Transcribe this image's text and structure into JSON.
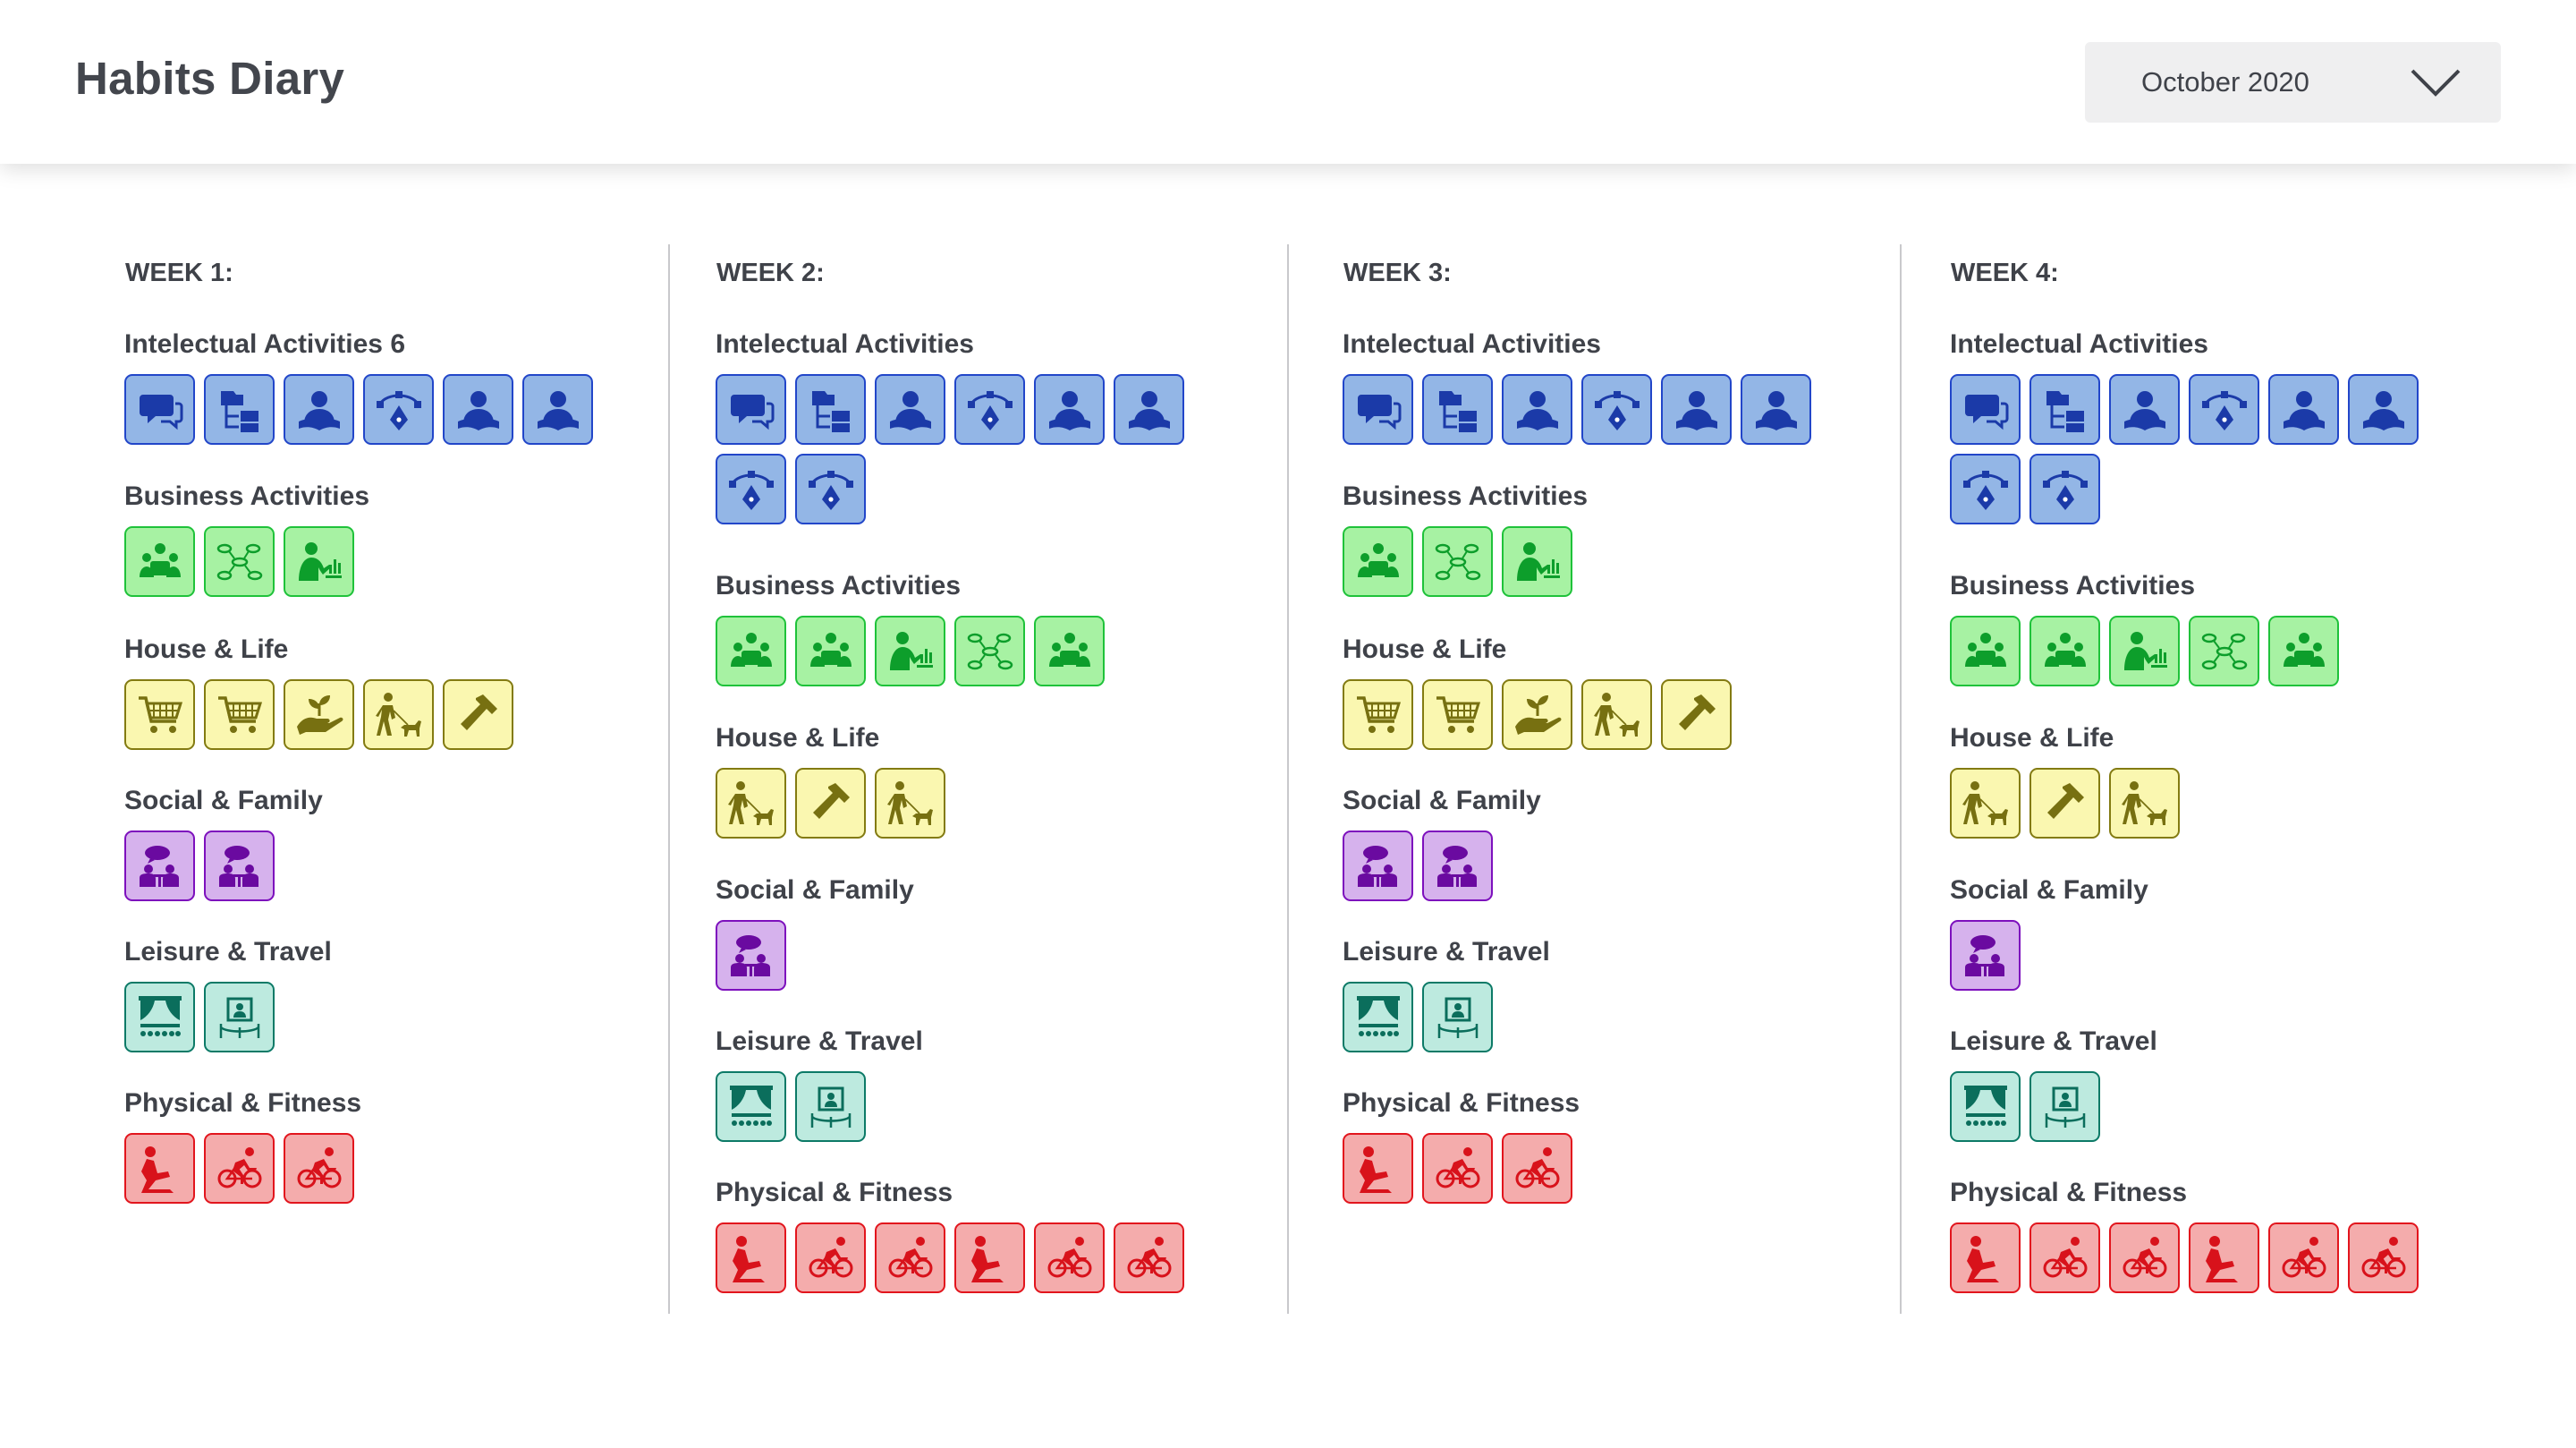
{
  "app": {
    "title": "Habits Diary"
  },
  "month_select": {
    "value": "October 2020"
  },
  "weeks": [
    {
      "title": "WEEK 1:",
      "categories": [
        {
          "title": "Intelectual Activities 6",
          "color": "blue",
          "icons": [
            "chat-icon",
            "file-tree-icon",
            "reading-icon",
            "pen-tool-icon",
            "reading-icon",
            "reading-icon"
          ]
        },
        {
          "title": "Business Activities",
          "color": "green",
          "icons": [
            "meeting-icon",
            "mind-map-icon",
            "presentation-icon"
          ]
        },
        {
          "title": "House & Life",
          "color": "yellow",
          "icons": [
            "shopping-cart-icon",
            "shopping-cart-icon",
            "plant-hand-icon",
            "dog-walk-icon",
            "hammer-icon"
          ]
        },
        {
          "title": "Social & Family",
          "color": "purple",
          "icons": [
            "conversation-icon",
            "conversation-icon"
          ]
        },
        {
          "title": "Leisure & Travel",
          "color": "teal",
          "icons": [
            "theater-icon",
            "museum-icon"
          ]
        },
        {
          "title": "Physical & Fitness",
          "color": "red",
          "icons": [
            "yoga-icon",
            "cycling-icon",
            "cycling-icon"
          ]
        }
      ]
    },
    {
      "title": "WEEK 2:",
      "categories": [
        {
          "title": "Intelectual Activities",
          "color": "blue",
          "icons": [
            "chat-icon",
            "file-tree-icon",
            "reading-icon",
            "pen-tool-icon",
            "reading-icon",
            "reading-icon",
            "pen-tool-icon",
            "pen-tool-icon"
          ]
        },
        {
          "title": "Business Activities",
          "color": "green",
          "icons": [
            "meeting-icon",
            "meeting-icon",
            "presentation-icon",
            "mind-map-icon",
            "meeting-icon"
          ]
        },
        {
          "title": "House & Life",
          "color": "yellow",
          "icons": [
            "dog-walk-icon",
            "hammer-icon",
            "dog-walk-icon"
          ]
        },
        {
          "title": "Social & Family",
          "color": "purple",
          "icons": [
            "conversation-icon"
          ]
        },
        {
          "title": "Leisure & Travel",
          "color": "teal",
          "icons": [
            "theater-icon",
            "museum-icon"
          ]
        },
        {
          "title": "Physical & Fitness",
          "color": "red",
          "icons": [
            "yoga-icon",
            "cycling-icon",
            "cycling-icon",
            "yoga-icon",
            "cycling-icon",
            "cycling-icon"
          ]
        }
      ]
    },
    {
      "title": "WEEK 3:",
      "categories": [
        {
          "title": "Intelectual Activities",
          "color": "blue",
          "icons": [
            "chat-icon",
            "file-tree-icon",
            "reading-icon",
            "pen-tool-icon",
            "reading-icon",
            "reading-icon"
          ]
        },
        {
          "title": "Business Activities",
          "color": "green",
          "icons": [
            "meeting-icon",
            "mind-map-icon",
            "presentation-icon"
          ]
        },
        {
          "title": "House & Life",
          "color": "yellow",
          "icons": [
            "shopping-cart-icon",
            "shopping-cart-icon",
            "plant-hand-icon",
            "dog-walk-icon",
            "hammer-icon"
          ]
        },
        {
          "title": "Social & Family",
          "color": "purple",
          "icons": [
            "conversation-icon",
            "conversation-icon"
          ]
        },
        {
          "title": "Leisure & Travel",
          "color": "teal",
          "icons": [
            "theater-icon",
            "museum-icon"
          ]
        },
        {
          "title": "Physical & Fitness",
          "color": "red",
          "icons": [
            "yoga-icon",
            "cycling-icon",
            "cycling-icon"
          ]
        }
      ]
    },
    {
      "title": "WEEK 4:",
      "categories": [
        {
          "title": "Intelectual Activities",
          "color": "blue",
          "icons": [
            "chat-icon",
            "file-tree-icon",
            "reading-icon",
            "pen-tool-icon",
            "reading-icon",
            "reading-icon",
            "pen-tool-icon",
            "pen-tool-icon"
          ]
        },
        {
          "title": "Business Activities",
          "color": "green",
          "icons": [
            "meeting-icon",
            "meeting-icon",
            "presentation-icon",
            "mind-map-icon",
            "meeting-icon"
          ]
        },
        {
          "title": "House & Life",
          "color": "yellow",
          "icons": [
            "dog-walk-icon",
            "hammer-icon",
            "dog-walk-icon"
          ]
        },
        {
          "title": "Social & Family",
          "color": "purple",
          "icons": [
            "conversation-icon"
          ]
        },
        {
          "title": "Leisure & Travel",
          "color": "teal",
          "icons": [
            "theater-icon",
            "museum-icon"
          ]
        },
        {
          "title": "Physical & Fitness",
          "color": "red",
          "icons": [
            "yoga-icon",
            "cycling-icon",
            "cycling-icon",
            "yoga-icon",
            "cycling-icon",
            "cycling-icon"
          ]
        }
      ]
    }
  ],
  "colors": {
    "blue": "#93b6e6",
    "green": "#a7f2a3",
    "yellow": "#faf7b0",
    "purple": "#d6b2ed",
    "teal": "#bdeadf",
    "red": "#f4acac"
  }
}
